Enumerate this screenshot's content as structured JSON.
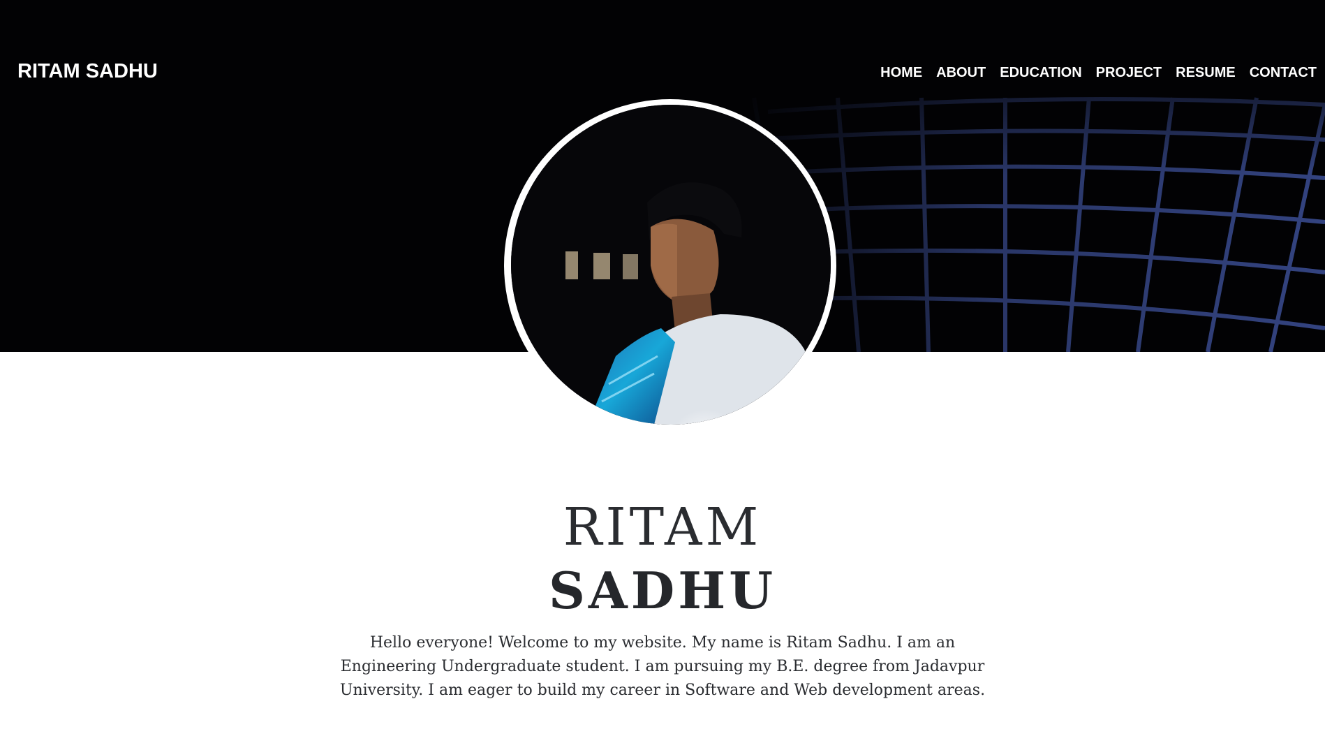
{
  "header": {
    "brand": "RITAM SADHU",
    "nav": [
      "HOME",
      "ABOUT",
      "EDUCATION",
      "PROJECT",
      "RESUME",
      "CONTACT"
    ]
  },
  "profile": {
    "photo_icon": "profile-photo",
    "first_name": "RITAM",
    "last_name": "SADHU",
    "bio": "Hello everyone! Welcome to my website. My name is Ritam Sadhu. I am an Engineering Undergraduate student. I am pursuing my B.E. degree from Jadavpur University. I am eager to build my career in Software and Web development areas."
  },
  "colors": {
    "hero_background": "#020204",
    "grid_lines": "#3a4a8a",
    "text": "#25272b",
    "nav_text": "#ffffff"
  }
}
